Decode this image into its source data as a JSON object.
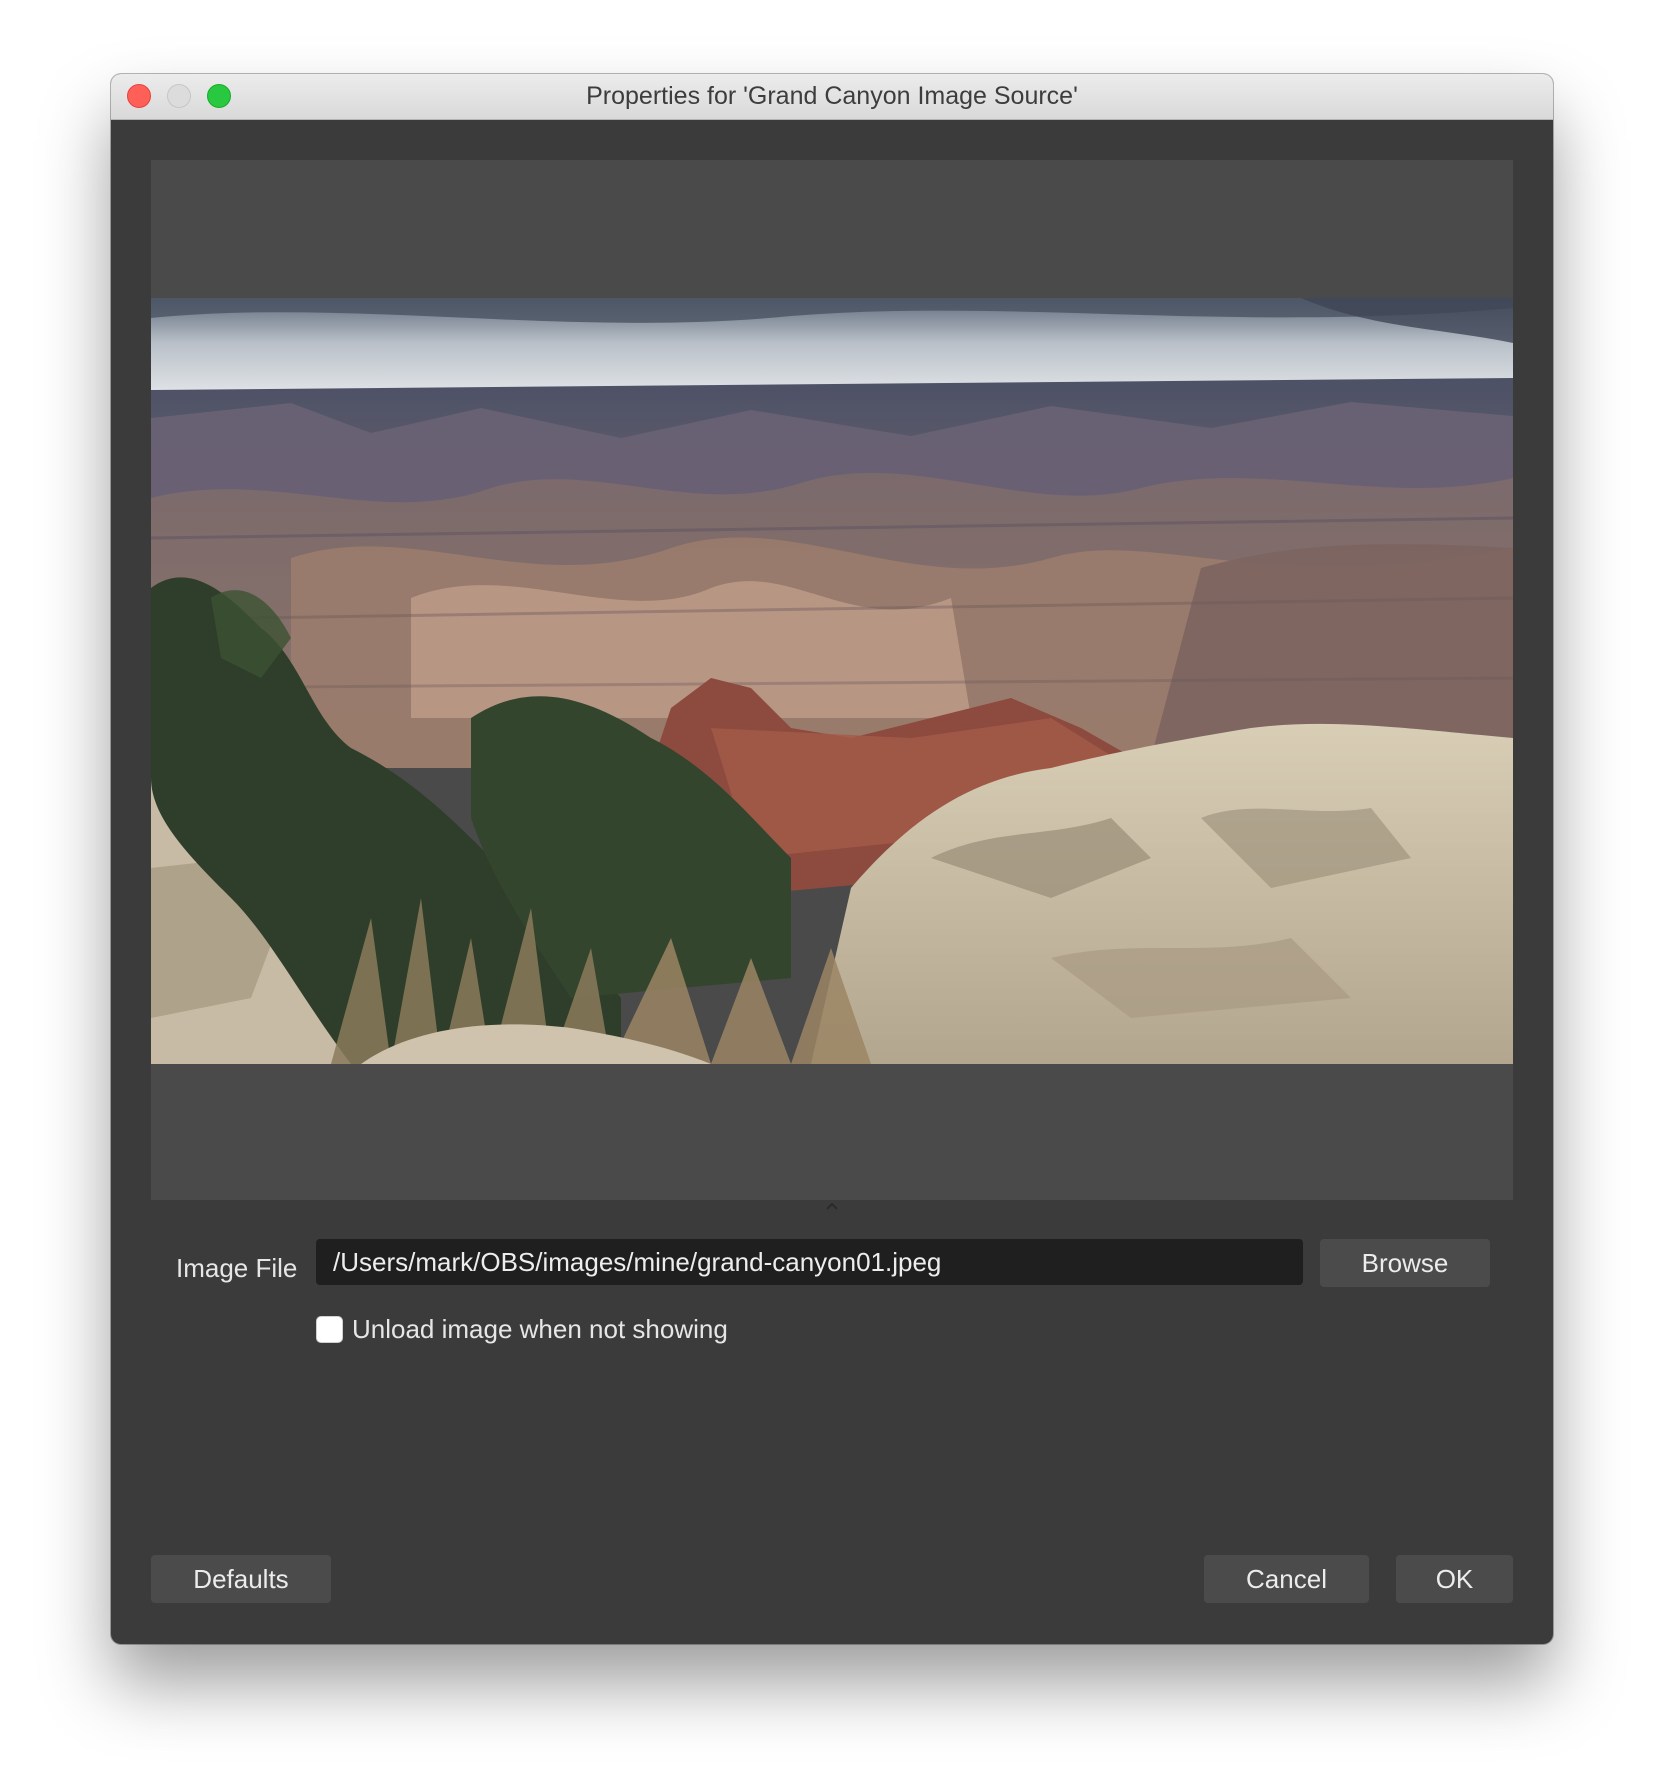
{
  "window": {
    "title": "Properties for 'Grand Canyon Image Source'"
  },
  "preview": {
    "image_icon": "landscape-photo"
  },
  "form": {
    "image_file_label": "Image File",
    "image_file_value": "/Users/mark/OBS/images/mine/grand-canyon01.jpeg",
    "browse_label": "Browse",
    "unload_checkbox_label": "Unload image when not showing",
    "unload_checked": false
  },
  "footer": {
    "defaults_label": "Defaults",
    "cancel_label": "Cancel",
    "ok_label": "OK"
  },
  "colors": {
    "window_bg": "#3b3b3b",
    "preview_bg": "#4a4a4a",
    "field_bg": "#1f1f1f",
    "button_bg": "#4b4b4b",
    "close": "#fe5f57",
    "maximize": "#28c840"
  }
}
